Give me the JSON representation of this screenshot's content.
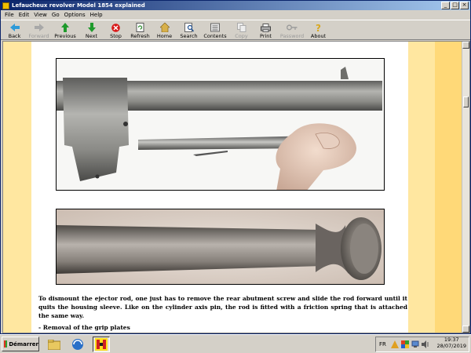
{
  "window": {
    "title": "Lefaucheux revolver Model 1854 explained",
    "controls": [
      "_",
      "□",
      "×"
    ]
  },
  "menu": [
    "File",
    "Edit",
    "View",
    "Go",
    "Options",
    "Help"
  ],
  "toolbar": [
    {
      "label": "Back",
      "icon": "back-arrow-icon",
      "enabled": true
    },
    {
      "label": "Forward",
      "icon": "forward-arrow-icon",
      "enabled": false
    },
    {
      "label": "Previous",
      "icon": "up-arrow-icon",
      "enabled": true
    },
    {
      "label": "Next",
      "icon": "down-arrow-icon",
      "enabled": true
    },
    {
      "label": "Stop",
      "icon": "stop-icon",
      "enabled": true
    },
    {
      "label": "Refresh",
      "icon": "refresh-icon",
      "enabled": true
    },
    {
      "label": "Home",
      "icon": "home-icon",
      "enabled": true
    },
    {
      "label": "Search",
      "icon": "search-icon",
      "enabled": true
    },
    {
      "label": "Contents",
      "icon": "contents-icon",
      "enabled": true
    },
    {
      "label": "Copy",
      "icon": "copy-icon",
      "enabled": false
    },
    {
      "label": "Print",
      "icon": "print-icon",
      "enabled": true
    },
    {
      "label": "Password",
      "icon": "key-icon",
      "enabled": false
    },
    {
      "label": "About",
      "icon": "about-icon",
      "enabled": true
    }
  ],
  "page": {
    "paragraph": "To dismount the ejector rod, one just has to remove the rear abutment screw and slide the rod forward until it quits the housing sleeve. Like on the cylinder axis pin, the rod is fitted with a friction spring that is attached the same way.",
    "section_heading": "- Removal of the grip plates"
  },
  "taskbar": {
    "start_label": "Démarrer",
    "lang": "FR",
    "time": "19:37",
    "date": "28/07/2019"
  },
  "colors": {
    "side_band": "#ffe7a0",
    "titlebar": "#0a246a"
  }
}
